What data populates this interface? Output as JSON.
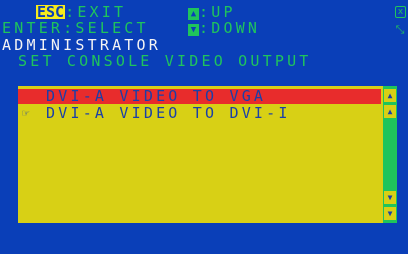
{
  "header": {
    "esc_key": "ESC",
    "esc_action": ":EXIT",
    "up_arrow_glyph": "▲",
    "up_action": ":UP",
    "enter_key": "ENTER",
    "enter_action": ":SELECT",
    "down_arrow_glyph": "▼",
    "down_action": ":DOWN"
  },
  "breadcrumb": {
    "level": "ADMINISTRATOR",
    "page_title": "SET CONSOLE VIDEO OUTPUT"
  },
  "corner_icons": {
    "close_glyph": "x",
    "resize_glyph": "⤡"
  },
  "options": {
    "items": [
      {
        "label": "DVI-A VIDEO TO VGA",
        "selected": true,
        "pointer": ""
      },
      {
        "label": "DVI-A VIDEO TO DVI-I",
        "selected": false,
        "pointer": "☞"
      }
    ]
  },
  "scrollbar": {
    "top_btn": "▲",
    "page_up_btn": "▲",
    "page_down_btn": "▼",
    "bottom_btn": "▼"
  },
  "colors": {
    "background": "#0a3fb8",
    "text_green": "#1fc45c",
    "key_highlight": "#f5ec1c",
    "panel_yellow": "#d8d015",
    "selection_red": "#e82c2c"
  }
}
